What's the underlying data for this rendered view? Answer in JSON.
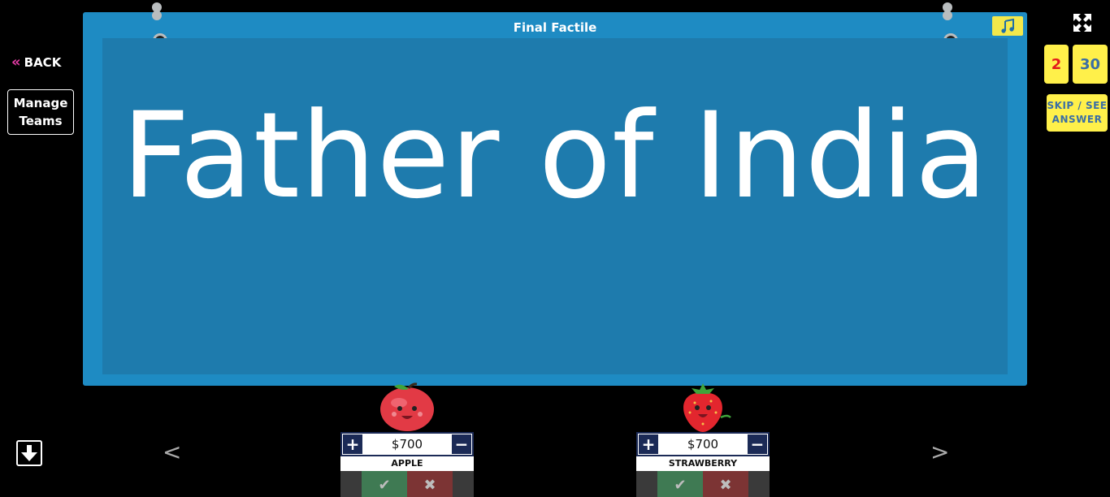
{
  "nav": {
    "back_label": "BACK",
    "back_chevron": "«",
    "manage_label": "Manage Teams"
  },
  "board": {
    "title": "Final Factile",
    "clue": "Father of India"
  },
  "controls": {
    "counter_left": "2",
    "counter_right": "30",
    "skip_label": "SKIP / SEE ANSWER",
    "prev_arrow": "<",
    "next_arrow": ">"
  },
  "teams": [
    {
      "name": "APPLE",
      "score": "$700",
      "plus": "+",
      "minus": "−",
      "avatar_icon": "apple-character-icon"
    },
    {
      "name": "STRAWBERRY",
      "score": "$700",
      "plus": "+",
      "minus": "−",
      "avatar_icon": "strawberry-character-icon"
    }
  ],
  "colors": {
    "board_frame": "#1e8bc3",
    "board_face": "#1e7bad",
    "accent_yellow": "#fff04a",
    "back_chevron": "#e83ca8",
    "counter_red": "#e31b1b",
    "counter_blue": "#3a6ea5"
  }
}
